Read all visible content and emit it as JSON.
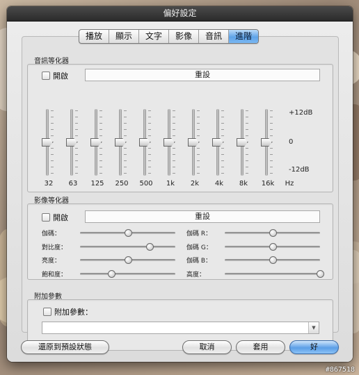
{
  "window": {
    "title": "偏好設定"
  },
  "tabs": [
    {
      "label": "播放",
      "active": false
    },
    {
      "label": "顯示",
      "active": false
    },
    {
      "label": "文字",
      "active": false
    },
    {
      "label": "影像",
      "active": false
    },
    {
      "label": "音訊",
      "active": false
    },
    {
      "label": "進階",
      "active": true
    }
  ],
  "audio_eq": {
    "section_label": "音訊等化器",
    "enable_label": "開啟",
    "enabled": false,
    "reset_label": "重設",
    "db_labels": {
      "max": "+12dB",
      "mid": "0",
      "min": "-12dB"
    },
    "unit": "Hz",
    "bands": [
      {
        "freq": "32",
        "gain_db": 0
      },
      {
        "freq": "63",
        "gain_db": 0
      },
      {
        "freq": "125",
        "gain_db": 0
      },
      {
        "freq": "250",
        "gain_db": 0
      },
      {
        "freq": "500",
        "gain_db": 0
      },
      {
        "freq": "1k",
        "gain_db": 0
      },
      {
        "freq": "2k",
        "gain_db": 0
      },
      {
        "freq": "4k",
        "gain_db": 0
      },
      {
        "freq": "8k",
        "gain_db": 0
      },
      {
        "freq": "16k",
        "gain_db": 0
      }
    ]
  },
  "video_eq": {
    "section_label": "影像等化器",
    "enable_label": "開啟",
    "enabled": false,
    "reset_label": "重設",
    "left": [
      {
        "label": "伽碼：",
        "value": 0.5
      },
      {
        "label": "對比度：",
        "value": 0.73
      },
      {
        "label": "亮度：",
        "value": 0.5
      },
      {
        "label": "飽和度：",
        "value": 0.33
      }
    ],
    "right": [
      {
        "label": "伽碼 R：",
        "value": 0.5
      },
      {
        "label": "伽碼 G：",
        "value": 0.5
      },
      {
        "label": "伽碼 B：",
        "value": 0.5
      },
      {
        "label": "高度：",
        "value": 1.0
      }
    ]
  },
  "extra": {
    "section_label": "附加參數",
    "checkbox_label": "附加參數：",
    "checked": false,
    "value": ""
  },
  "buttons": {
    "restore": "還原到預設狀態",
    "cancel": "取消",
    "apply": "套用",
    "ok": "好"
  },
  "watermark": "#867518"
}
